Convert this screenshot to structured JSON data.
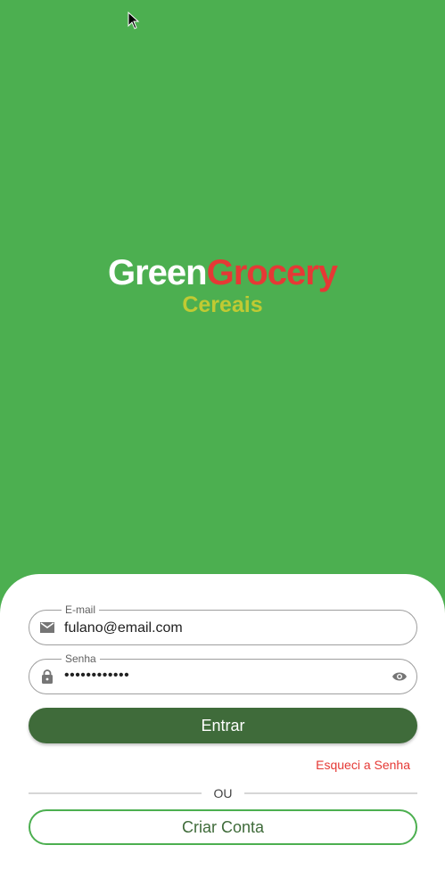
{
  "brand": {
    "title_part1": "Green",
    "title_part2": "Grocery",
    "subtitle": "Cereais"
  },
  "login": {
    "email_label": "E-mail",
    "email_value": "fulano@email.com",
    "password_label": "Senha",
    "password_value": "••••••••••••",
    "submit_label": "Entrar",
    "forgot_label": "Esqueci a Senha",
    "divider_label": "OU",
    "create_label": "Criar Conta"
  },
  "icons": {
    "email": "mail-icon",
    "password": "lock-icon",
    "visibility": "eye-icon",
    "cursor": "mouse-cursor-icon"
  },
  "colors": {
    "background": "#4caf50",
    "brand_red": "#e53935",
    "subtitle": "#c0ca33",
    "primary_button": "#3f6b3a"
  }
}
